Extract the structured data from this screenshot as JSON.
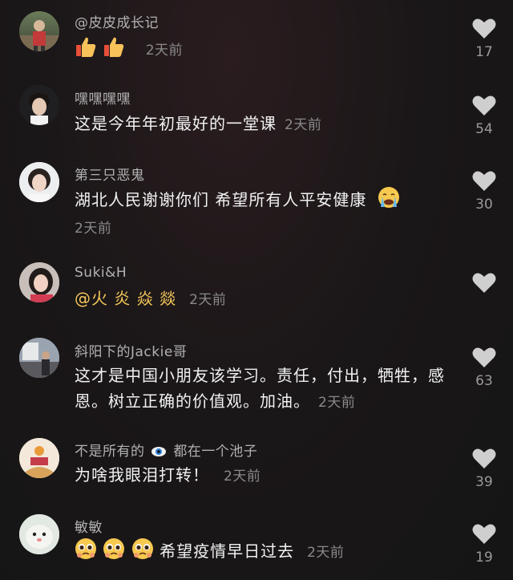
{
  "comments": [
    {
      "username": "@皮皮成长记",
      "text": "",
      "time": "2天前",
      "likes": "17"
    },
    {
      "username": "嘿嘿嘿嘿",
      "text": "这是今年年初最好的一堂课",
      "time": "2天前",
      "likes": "54"
    },
    {
      "username": "第三只恶鬼",
      "text": "湖北人民谢谢你们 希望所有人平安健康",
      "time": "2天前",
      "likes": "30"
    },
    {
      "username": "Suki&H",
      "text": "@火 炎 焱 燚",
      "time": "2天前",
      "likes": ""
    },
    {
      "username": "斜阳下的Jackie哥",
      "text": "这才是中国小朋友该学习。责任，付出，牺牲，感恩。树立正确的价值观。加油。",
      "time": "2天前",
      "likes": "63"
    },
    {
      "username_before": "不是所有的",
      "username_after": "都在一个池子",
      "text": "为啥我眼泪打转！",
      "time": "2天前",
      "likes": "39"
    },
    {
      "username": "敏敏",
      "text": "希望疫情早日过去",
      "time": "2天前",
      "likes": "19"
    }
  ],
  "icons": {
    "like": "heart-icon",
    "thumbs_up": "thumbs-up-emoji",
    "crying": "crying-face-emoji",
    "pleading": "pleading-face-emoji",
    "eye": "eye-emoji"
  },
  "colors": {
    "mention": "#f5c85a",
    "username": "#b2b2b2",
    "text": "#f2f2f2",
    "meta": "#8a8a8a"
  }
}
